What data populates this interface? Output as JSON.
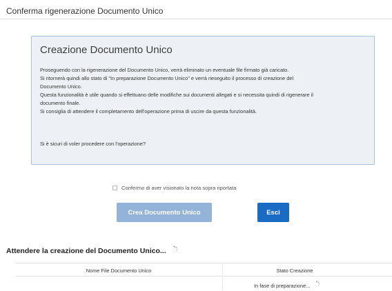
{
  "page": {
    "title": "Conferma rigenerazione Documento Unico"
  },
  "info_panel": {
    "heading": "Creazione Documento Unico",
    "lines": [
      "Proseguendo con la rigenerazione del Documento Unico, verrà eliminato un eventuale file firmato già caricato.",
      "Si ritornerà quindi allo stato di \"In preparazione Documento Unico\" e verrà rieseguito il processo di creazione del",
      "Documento Unico.",
      "Questa funzionalità è utile quando si effettuano delle modifiche sui documenti allegati e si necessita quindi di rigenerare il",
      "documento finale.",
      "Si consiglia di attendere il completamento dell'operazione prima di uscire da questa funzionalità."
    ],
    "question": "Si è sicuri di voler procedere con l'operazione?"
  },
  "confirm_checkbox": {
    "label": "Confermo di aver visionato la nota sopra riportata",
    "checked": false
  },
  "buttons": {
    "create_label": "Crea Documento Unico",
    "exit_label": "Esci"
  },
  "progress": {
    "heading": "Attendere la creazione del Documento Unico..."
  },
  "table": {
    "columns": [
      "Nome File Documento Unico",
      "Stato Creazione"
    ],
    "rows": [
      {
        "name": "",
        "status": "In fase di preparazione..."
      }
    ]
  },
  "icons": {
    "spinner": "loading-spinner-icon"
  },
  "colors": {
    "panel_bg": "#edf1f5",
    "panel_border": "#a8c1d9",
    "primary_button": "#1a6bc4",
    "disabled_button": "#93b3d8"
  }
}
